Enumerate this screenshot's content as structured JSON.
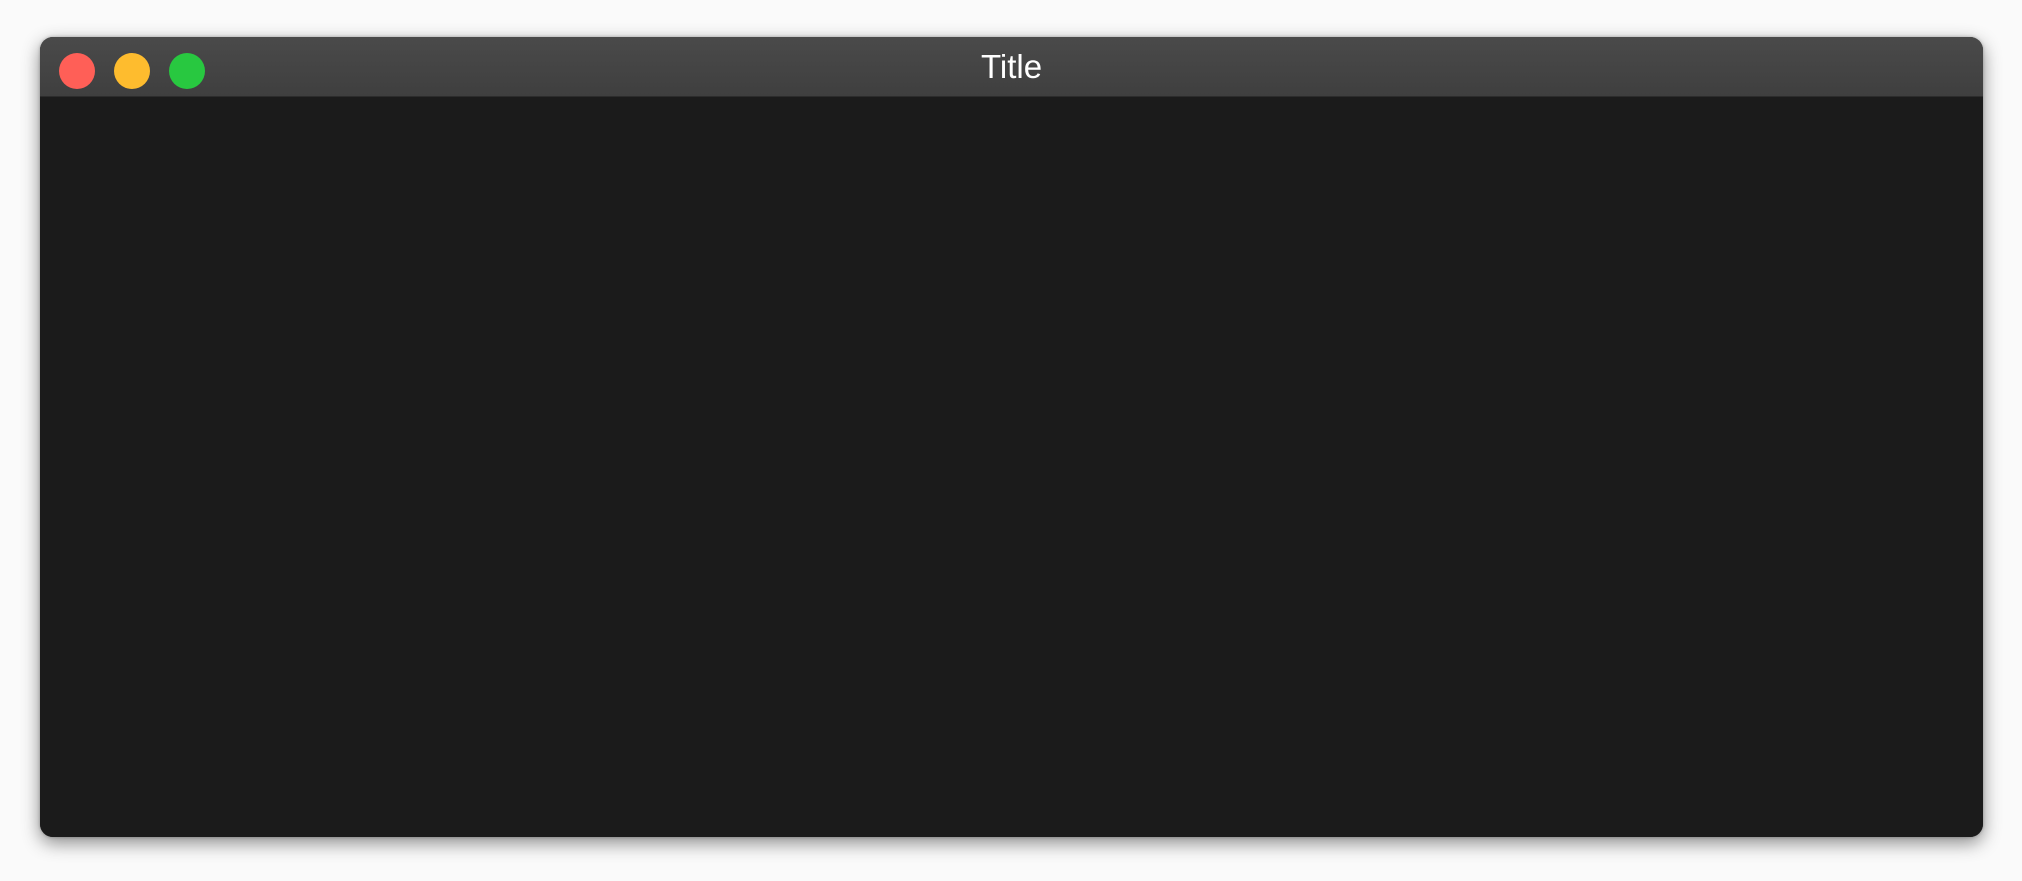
{
  "window": {
    "title": "Title"
  },
  "traffic_lights": [
    {
      "name": "close",
      "color": "#ff5f57"
    },
    {
      "name": "minimize",
      "color": "#febc2e"
    },
    {
      "name": "maximize",
      "color": "#28c840"
    }
  ],
  "colors": {
    "titlebar": "#454545",
    "content_background": "#1b1b1b",
    "page_background": "#fafafa"
  }
}
